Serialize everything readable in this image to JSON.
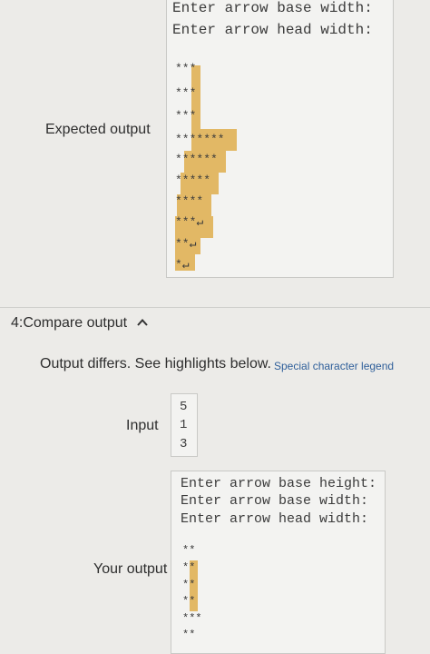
{
  "expected_section": {
    "label": "Expected output",
    "prompts": [
      "Enter arrow base width:",
      "Enter arrow head width:"
    ],
    "arrow_rows": [
      "***",
      "***",
      "***",
      "*******",
      "******",
      "*****",
      "****",
      "***↵",
      "**↵",
      "*↵"
    ]
  },
  "compare_section": {
    "title": "4:Compare output",
    "toggle_icon": "chevron-up-icon",
    "diff_message": "Output differs. See highlights below.",
    "legend_link": "Special character legend"
  },
  "input_section": {
    "label": "Input",
    "values": [
      "5",
      "1",
      "3"
    ]
  },
  "your_output_section": {
    "label": "Your output",
    "prompts": [
      "Enter arrow base height:",
      "Enter arrow base width:",
      "Enter arrow head width:"
    ],
    "arrow_rows": [
      "**",
      "**",
      "**",
      "**",
      "***",
      "**"
    ]
  },
  "colors": {
    "highlight": "#e2b865",
    "background": "#ecebe8",
    "box": "#f3f3f1",
    "link": "#2f5f9a"
  }
}
